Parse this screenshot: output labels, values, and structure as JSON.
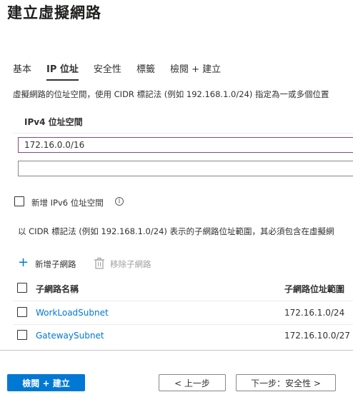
{
  "page": {
    "title": "建立虛擬網路"
  },
  "tabs": [
    {
      "label": "基本"
    },
    {
      "label": "IP 位址"
    },
    {
      "label": "安全性"
    },
    {
      "label": "標籤"
    },
    {
      "label": "檢閱 + 建立"
    }
  ],
  "address_space": {
    "description": "虛擬網路的位址空間，使用 CIDR 標記法 (例如 192.168.1.0/24) 指定為一或多個位置",
    "ipv4_label": "IPv4 位址空間",
    "values": [
      "172.16.0.0/16",
      ""
    ]
  },
  "ipv6": {
    "label": "新增 IPv6 位址空間",
    "checked": false,
    "info_icon": "info-icon"
  },
  "subnets": {
    "description": "以 CIDR 標記法 (例如 192.168.1.0/24) 表示的子網路位址範圍，其必須包含在虛擬網",
    "add_label": "新增子網路",
    "remove_label": "移除子網路",
    "columns": {
      "name": "子網路名稱",
      "range": "子網路位址範圍"
    },
    "rows": [
      {
        "name": "WorkLoadSubnet",
        "range": "172.16.1.0/24"
      },
      {
        "name": "GatewaySubnet",
        "range": "172.16.10.0/27"
      }
    ]
  },
  "footer": {
    "review_create": "檢閱 + 建立",
    "previous": "< 上一步",
    "next": "下一步：安全性 >"
  },
  "colors": {
    "accent": "#0078d4",
    "focus_border": "#8a4a7b",
    "text": "#323130",
    "disabled": "#a19f9d"
  }
}
